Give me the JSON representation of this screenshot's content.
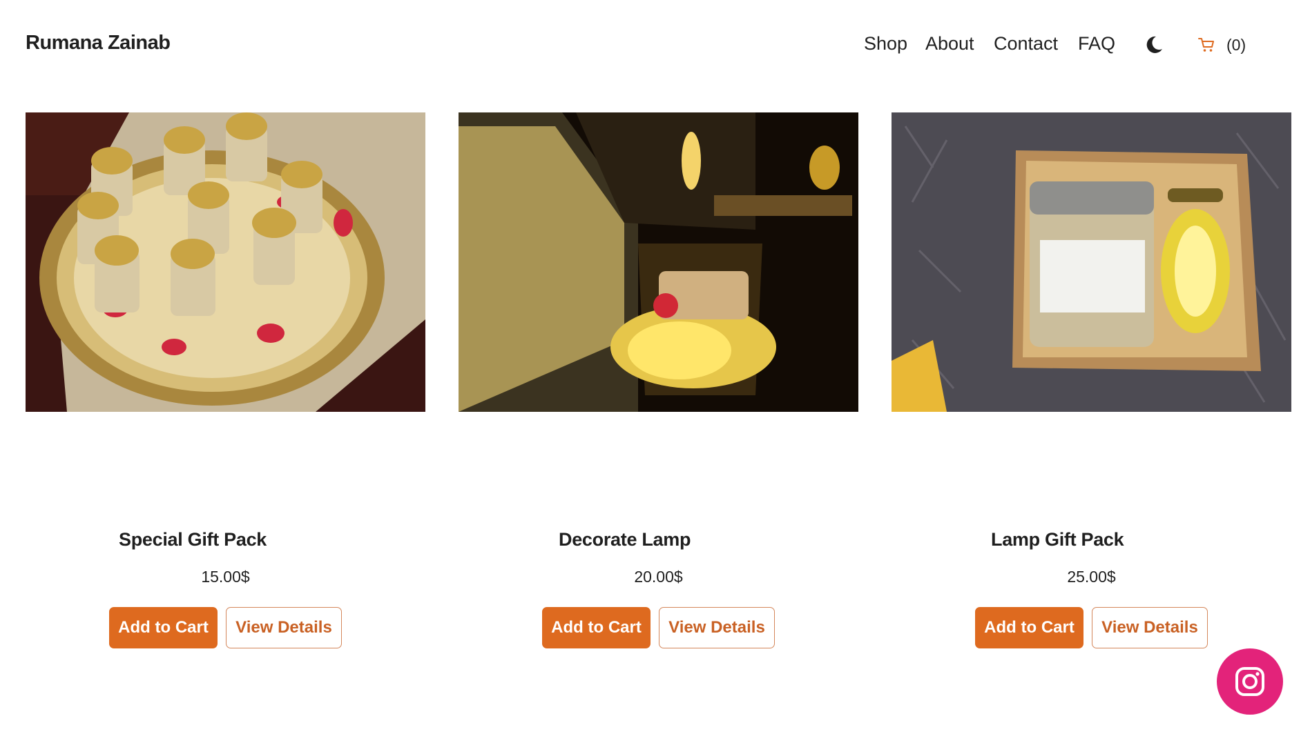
{
  "brand": {
    "name": "Rumana Zainab"
  },
  "nav": {
    "items": [
      {
        "label": "Shop"
      },
      {
        "label": "About"
      },
      {
        "label": "Contact"
      },
      {
        "label": "FAQ"
      }
    ],
    "theme_icon": "moon-icon",
    "cart": {
      "icon": "cart-icon",
      "count_label": "(0)"
    }
  },
  "products": [
    {
      "name": "Special Gift Pack",
      "price": "15.00$",
      "add_label": "Add to Cart",
      "view_label": "View Details"
    },
    {
      "name": "Decorate Lamp",
      "price": "20.00$",
      "add_label": "Add to Cart",
      "view_label": "View Details"
    },
    {
      "name": "Lamp Gift Pack",
      "price": "25.00$",
      "add_label": "Add to Cart",
      "view_label": "View Details"
    }
  ],
  "social": {
    "icon": "instagram-icon"
  },
  "colors": {
    "accent": "#de6a1f",
    "outline_text": "#c96124",
    "instagram": "#e3237a",
    "text": "#1f1f1f"
  }
}
